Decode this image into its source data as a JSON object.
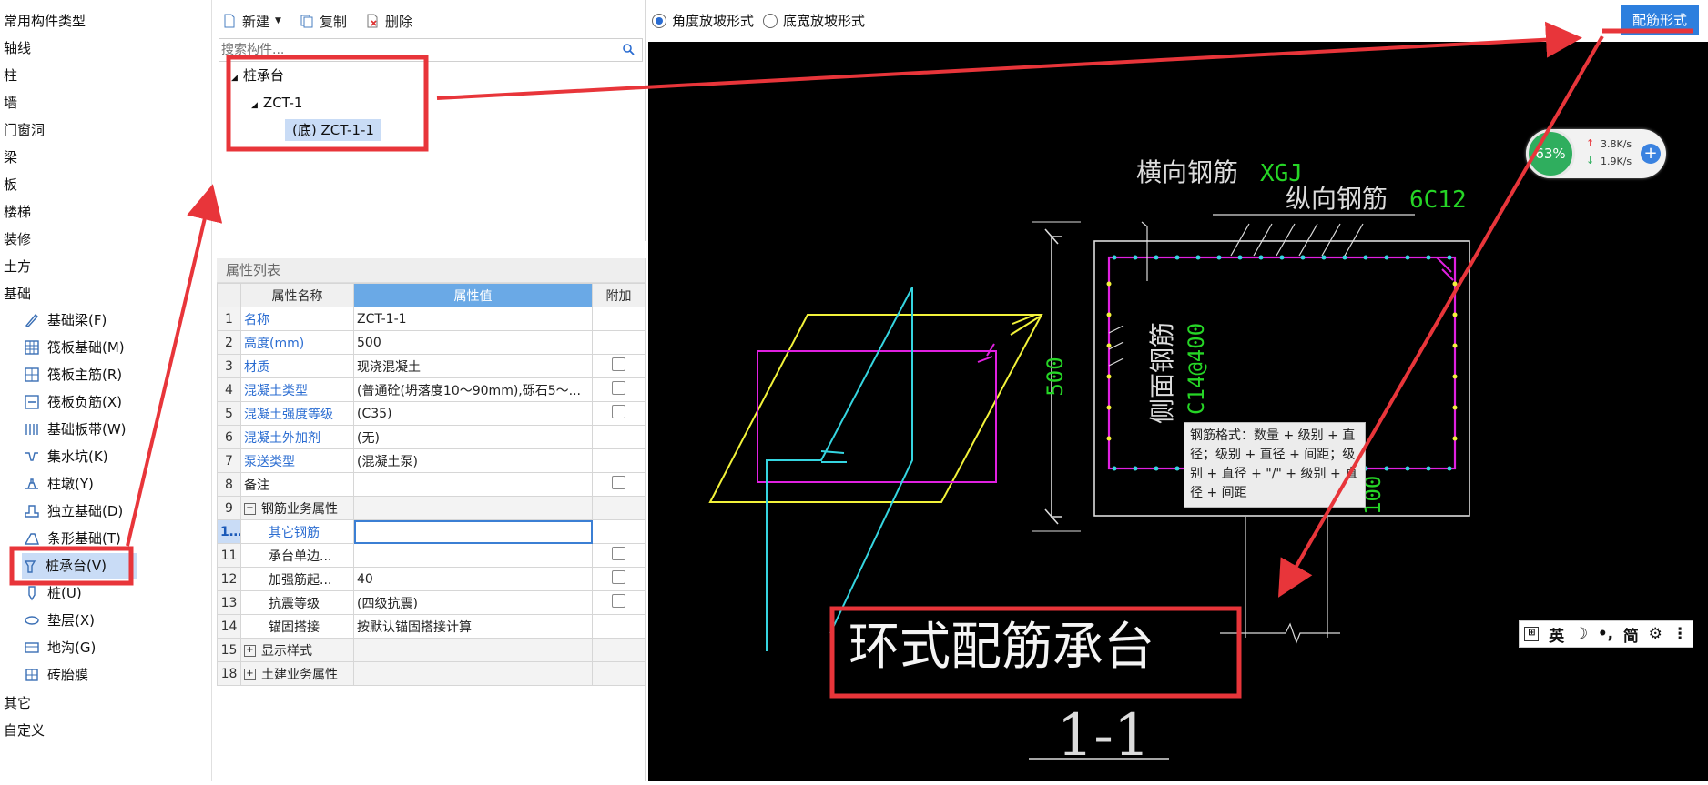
{
  "left_tree": {
    "categories": [
      "常用构件类型",
      "轴线",
      "柱",
      "墙",
      "门窗洞",
      "梁",
      "板",
      "楼梯",
      "装修",
      "土方",
      "基础"
    ],
    "foundation_items": [
      "基础梁(F)",
      "筏板基础(M)",
      "筏板主筋(R)",
      "筏板负筋(X)",
      "基础板带(W)",
      "集水坑(K)",
      "柱墩(Y)",
      "独立基础(D)",
      "条形基础(T)",
      "桩承台(V)",
      "桩(U)",
      "垫层(X)",
      "地沟(G)",
      "砖胎膜"
    ],
    "bottom_categories": [
      "其它",
      "自定义"
    ]
  },
  "toolbar": {
    "new_label": "新建",
    "copy_label": "复制",
    "delete_label": "删除"
  },
  "search": {
    "placeholder": "搜索构件..."
  },
  "component_tree": {
    "root": "桩承台",
    "child": "ZCT-1",
    "leaf": "(底) ZCT-1-1"
  },
  "properties": {
    "title": "属性列表",
    "headers": {
      "name": "属性名称",
      "value": "属性值",
      "extra": "附加"
    },
    "rows": [
      {
        "n": "1",
        "name": "名称",
        "value": "ZCT-1-1"
      },
      {
        "n": "2",
        "name": "高度(mm)",
        "value": "500"
      },
      {
        "n": "3",
        "name": "材质",
        "value": "现浇混凝土"
      },
      {
        "n": "4",
        "name": "混凝土类型",
        "value": "(普通砼(坍落度10～90mm),砾石5～..."
      },
      {
        "n": "5",
        "name": "混凝土强度等级",
        "value": "(C35)"
      },
      {
        "n": "6",
        "name": "混凝土外加剂",
        "value": "(无)"
      },
      {
        "n": "7",
        "name": "泵送类型",
        "value": "(混凝土泵)"
      },
      {
        "n": "8",
        "name": "备注",
        "value": ""
      },
      {
        "n": "9",
        "name": "钢筋业务属性",
        "value": ""
      },
      {
        "n": "10",
        "name": "其它钢筋",
        "value": ""
      },
      {
        "n": "11",
        "name": "承台单边...",
        "value": ""
      },
      {
        "n": "12",
        "name": "加强筋起...",
        "value": "40"
      },
      {
        "n": "13",
        "name": "抗震等级",
        "value": "(四级抗震)"
      },
      {
        "n": "14",
        "name": "锚固搭接",
        "value": "按默认锚固搭接计算"
      },
      {
        "n": "15",
        "name": "显示样式",
        "value": ""
      },
      {
        "n": "18",
        "name": "土建业务属性",
        "value": ""
      }
    ]
  },
  "top_bar": {
    "radio_angle": "角度放坡形式",
    "radio_width": "底宽放坡形式",
    "config_button": "配筋形式"
  },
  "drawing": {
    "label_xgj": "横向钢筋",
    "label_xgj_code": "XGJ",
    "label_zgj": "纵向钢筋",
    "label_zgj_code": "6C12",
    "label_side": "侧面钢筋",
    "label_side_code": "C14@400",
    "dim_500": "500",
    "dim_100": "100",
    "title": "环式配筋承台",
    "section": "1-1"
  },
  "tooltip": {
    "text": "钢筋格式：数量 + 级别 + 直径；级别 + 直径 + 间距；级别 + 直径 + \"/\" + 级别 + 直径 + 间距"
  },
  "net_widget": {
    "percent": "63%",
    "up": "3.8K/s",
    "down": "1.9K/s"
  },
  "ime": {
    "lang": "英",
    "mode": "简"
  },
  "colors": {
    "accent": "#2d7fde",
    "annotation": "#e8353a",
    "rebar_green": "#26d626",
    "magenta": "#e020e0",
    "yellow": "#f2f23a",
    "cyan": "#35d5e0"
  }
}
